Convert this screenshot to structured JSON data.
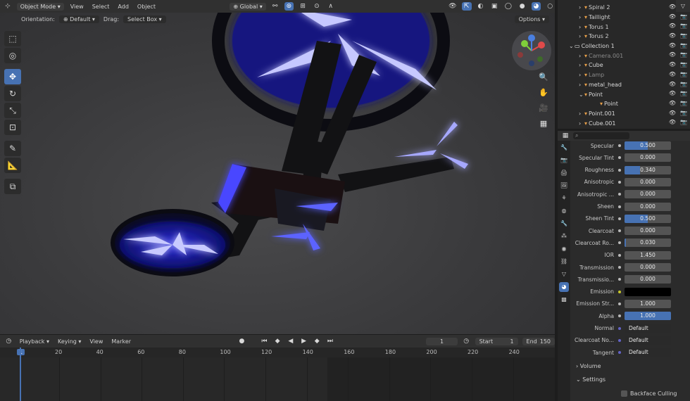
{
  "header": {
    "mode": "Object Mode",
    "menus": [
      "View",
      "Select",
      "Add",
      "Object"
    ],
    "transform_orientation": "Global",
    "options_label": "Options"
  },
  "tool_settings": {
    "orientation_label": "Orientation:",
    "orientation_value": "Default",
    "drag_label": "Drag:",
    "drag_value": "Select Box"
  },
  "timeline": {
    "menus": [
      "Playback",
      "Keying",
      "View",
      "Marker"
    ],
    "current_frame": "1",
    "start_label": "Start",
    "start_value": "1",
    "end_label": "End",
    "end_value": "150",
    "ruler_marks": [
      "1",
      "20",
      "40",
      "60",
      "80",
      "100",
      "120",
      "140",
      "160",
      "180",
      "200",
      "220",
      "240"
    ]
  },
  "outliner": {
    "items": [
      {
        "name": "Spiral 2"
      },
      {
        "name": "Taillight"
      },
      {
        "name": "Torus 1"
      },
      {
        "name": "Torus 2"
      },
      {
        "name": "Collection 1"
      },
      {
        "name": "Camera.001"
      },
      {
        "name": "Cube"
      },
      {
        "name": "Lamp"
      },
      {
        "name": "metal_head"
      },
      {
        "name": "Point"
      },
      {
        "name": "Point"
      },
      {
        "name": "Point.001"
      },
      {
        "name": "Cube.001"
      }
    ]
  },
  "properties": {
    "rows": [
      {
        "label": "Specular",
        "value": "0.500",
        "fill": 0.5
      },
      {
        "label": "Specular Tint",
        "value": "0.000",
        "fill": 0
      },
      {
        "label": "Roughness",
        "value": "0.340",
        "fill": 0.34
      },
      {
        "label": "Anisotropic",
        "value": "0.000",
        "fill": 0
      },
      {
        "label": "Anisotropic ...",
        "value": "0.000",
        "fill": 0
      },
      {
        "label": "Sheen",
        "value": "0.000",
        "fill": 0
      },
      {
        "label": "Sheen Tint",
        "value": "0.500",
        "fill": 0.5
      },
      {
        "label": "Clearcoat",
        "value": "0.000",
        "fill": 0
      },
      {
        "label": "Clearcoat Ro...",
        "value": "0.030",
        "fill": 0.03
      },
      {
        "label": "IOR",
        "value": "1.450",
        "fill": 0
      },
      {
        "label": "Transmission",
        "value": "0.000",
        "fill": 0
      },
      {
        "label": "Transmissio...",
        "value": "0.000",
        "fill": 0
      },
      {
        "label": "Emission",
        "value": "",
        "fill": 0,
        "color": "#000000"
      },
      {
        "label": "Emission Str...",
        "value": "1.000",
        "fill": 0
      },
      {
        "label": "Alpha",
        "value": "1.000",
        "fill": 1
      },
      {
        "label": "Normal",
        "value": "Default",
        "fill": 0,
        "link": true
      },
      {
        "label": "Clearcoat No...",
        "value": "Default",
        "fill": 0,
        "link": true
      },
      {
        "label": "Tangent",
        "value": "Default",
        "fill": 0,
        "link": true
      }
    ],
    "sections": {
      "volume": "Volume",
      "settings": "Settings"
    },
    "backface_culling": "Backface Culling"
  },
  "colors": {
    "accent": "#4772b3",
    "glow": "#3a3cff"
  }
}
